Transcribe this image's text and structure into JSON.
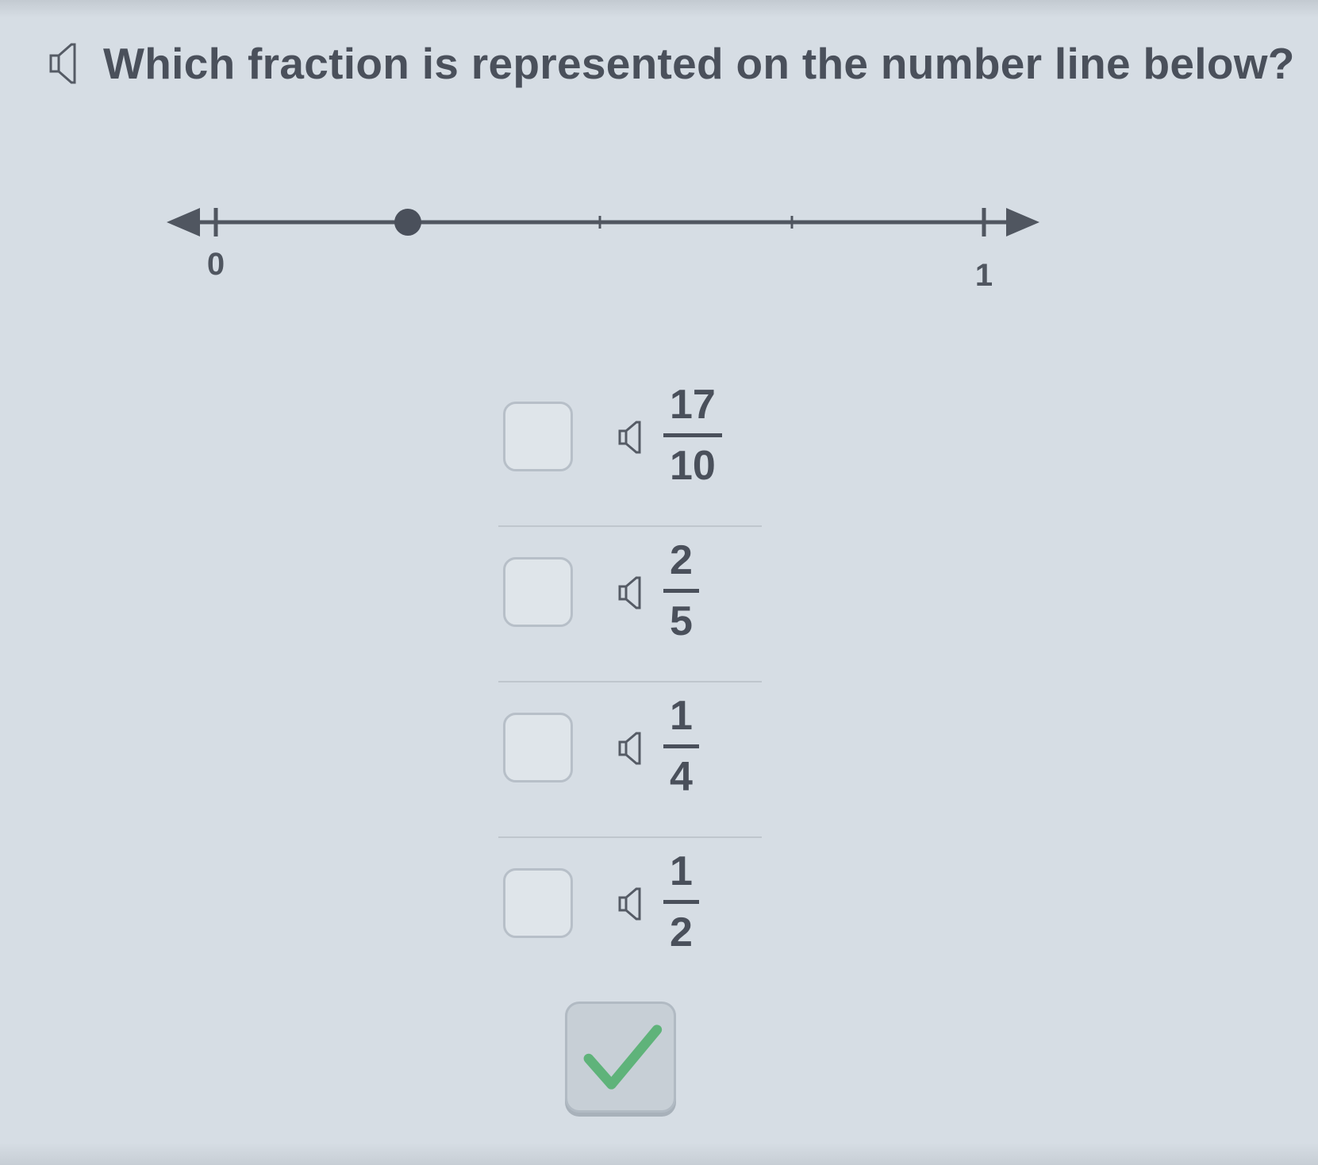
{
  "question": {
    "text": "Which fraction is represented on the number line below?",
    "speaker_icon": "speaker-icon"
  },
  "number_line": {
    "start_label": "0",
    "end_label": "1",
    "tick_values": [
      0,
      0.25,
      0.5,
      0.75,
      1
    ],
    "point_value": 0.25
  },
  "options": [
    {
      "numerator": "17",
      "denominator": "10",
      "checked": false
    },
    {
      "numerator": "2",
      "denominator": "5",
      "checked": false
    },
    {
      "numerator": "1",
      "denominator": "4",
      "checked": false
    },
    {
      "numerator": "1",
      "denominator": "2",
      "checked": false
    }
  ],
  "submit": {
    "icon": "checkmark-icon",
    "icon_color": "#5fb37a"
  },
  "colors": {
    "background": "#d6dde4",
    "text": "#4a505b",
    "number_line": "#505660"
  }
}
